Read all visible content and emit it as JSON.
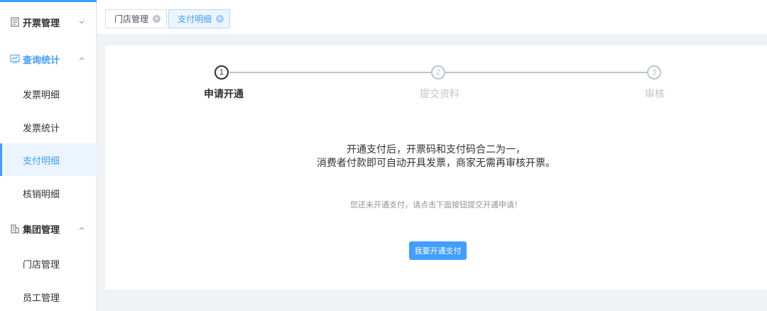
{
  "sidebar": {
    "groups": [
      {
        "label": "开票管理",
        "icon": "document-icon",
        "expanded": false
      },
      {
        "label": "查询统计",
        "icon": "chart-monitor-icon",
        "expanded": true
      },
      {
        "label": "集团管理",
        "icon": "building-icon",
        "expanded": true
      }
    ],
    "items": [
      {
        "label": "发票明细"
      },
      {
        "label": "发票统计"
      },
      {
        "label": "支付明细",
        "selected": true
      },
      {
        "label": "核销明细"
      },
      {
        "label": "门店管理"
      },
      {
        "label": "员工管理"
      }
    ]
  },
  "tabs": [
    {
      "label": "门店管理",
      "active": false
    },
    {
      "label": "支付明细",
      "active": true
    }
  ],
  "steps": [
    {
      "number": "1",
      "title": "申请开通",
      "status": "current"
    },
    {
      "number": "2",
      "title": "提交资料",
      "status": "wait"
    },
    {
      "number": "3",
      "title": "审核",
      "status": "wait"
    }
  ],
  "content": {
    "message_line1": "开通支付后，开票码和支付码合二为一，",
    "message_line2": "消费者付款即可自动开具发票，商家无需再审核开票。",
    "hint": "您还未开通支付，请点击下面按钮提交开通申请！",
    "button_label": "我要开通支付"
  },
  "colors": {
    "accent": "#409eff",
    "selected_bg": "#ecf5ff",
    "inactive_step": "#c0c4cc"
  }
}
